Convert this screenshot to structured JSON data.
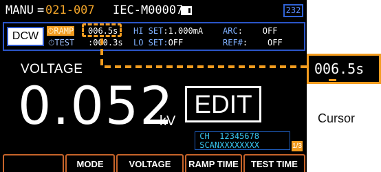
{
  "topbar": {
    "manu_label": "MANU",
    "manu_eq": "=",
    "manu_number": "021-007",
    "test_name": "IEC-M00007",
    "memory_icon": "memory-card-icon",
    "count": "232"
  },
  "settings": {
    "mode": "DCW",
    "ramp_label": "⏱RAMP",
    "ramp_value": "006.5s",
    "test_label": "⏱TEST",
    "test_value": ":000.3s",
    "hi_set_label": "HI SET",
    "hi_set_value": ":1.000mA",
    "lo_set_label": "LO SET:",
    "lo_set_value": "OFF",
    "arc_label": "ARC",
    "arc_value": ":    OFF",
    "ref_label": "REF#",
    "ref_value": ":    OFF"
  },
  "readout": {
    "label": "VOLTAGE",
    "value": "0.052",
    "unit": "kV"
  },
  "edit_label": "EDIT",
  "channels": {
    "ch_label": "CH",
    "ch_numbers": "12345678",
    "scan_label": "SCAN",
    "scan_values": "XXXXXXXX",
    "page": "1/3"
  },
  "softkeys": [
    "",
    "MODE",
    "VOLTAGE",
    "RAMP TIME",
    "TEST TIME"
  ],
  "callout": {
    "value": "006.5s",
    "caption": "Cursor"
  },
  "colors": {
    "accent": "#f39c1f",
    "panel_border": "#2b55c8",
    "channel_text": "#38c6f0"
  }
}
